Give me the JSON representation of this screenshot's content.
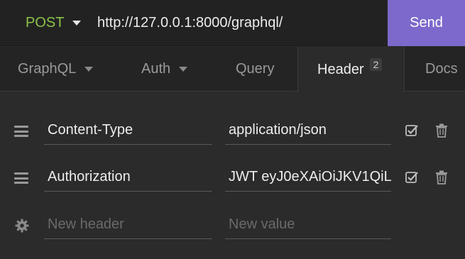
{
  "request": {
    "method": "POST",
    "url": "http://127.0.0.1:8000/graphql/",
    "send_label": "Send"
  },
  "tabs": [
    {
      "label": "GraphQL",
      "has_dropdown": true
    },
    {
      "label": "Auth",
      "has_dropdown": true
    },
    {
      "label": "Query",
      "has_dropdown": false
    },
    {
      "label": "Header",
      "badge": "2",
      "active": true
    },
    {
      "label": "Docs",
      "has_dropdown": false
    }
  ],
  "headers": [
    {
      "name": "Content-Type",
      "value": "application/json",
      "enabled": true
    },
    {
      "name": "Authorization",
      "value": "JWT eyJ0eXAiOiJKV1QiL",
      "enabled": true
    }
  ],
  "new_header": {
    "name_placeholder": "New header",
    "value_placeholder": "New value"
  },
  "colors": {
    "method": "#8bc34a",
    "send_button": "#7d69cb",
    "background": "#2b2b2b"
  },
  "icons": [
    "chevron-down-icon",
    "drag-handle-icon",
    "checkbox-checked-icon",
    "trash-icon",
    "gear-icon"
  ]
}
